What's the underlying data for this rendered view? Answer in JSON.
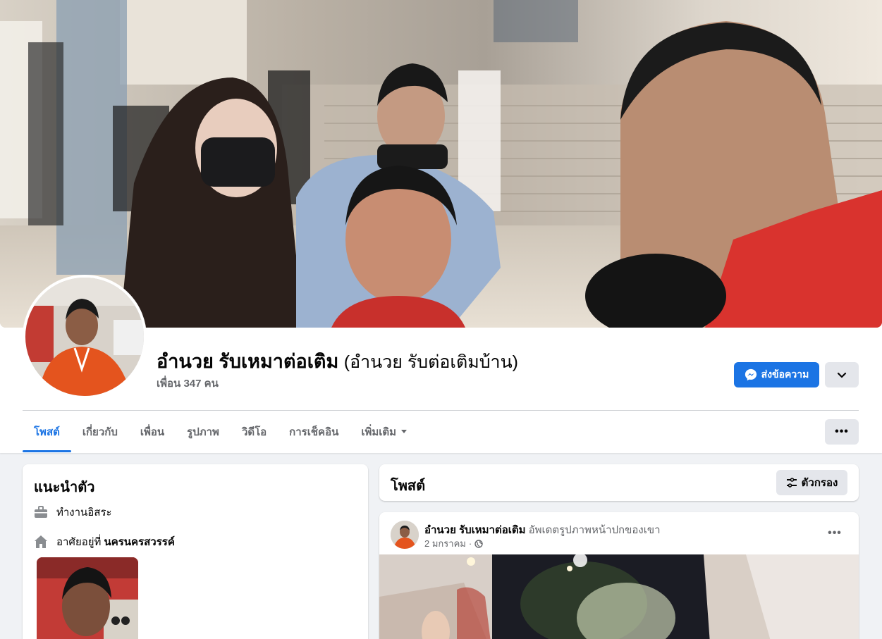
{
  "profile": {
    "name": "อำนวย รับเหมาต่อเติม",
    "alternate_name": "(อำนวย รับต่อเติมบ้าน)",
    "friends_text": "เพื่อน 347 คน",
    "message_button_label": "ส่งข้อความ"
  },
  "tabs": [
    {
      "label": "โพสต์",
      "active": true
    },
    {
      "label": "เกี่ยวกับ",
      "active": false
    },
    {
      "label": "เพื่อน",
      "active": false
    },
    {
      "label": "รูปภาพ",
      "active": false
    },
    {
      "label": "วิดีโอ",
      "active": false
    },
    {
      "label": "การเช็คอิน",
      "active": false
    },
    {
      "label": "เพิ่มเติม",
      "active": false
    }
  ],
  "intro": {
    "title": "แนะนำตัว",
    "work": "ทำงานอิสระ",
    "lives_prefix": "อาศัยอยู่ที่",
    "lives_place": "นครนครสวรรค์"
  },
  "posts": {
    "title": "โพสต์",
    "filter_label": "ตัวกรอง"
  },
  "post": {
    "author": "อำนวย รับเหมาต่อเติม",
    "action": "อัพเดตรูปภาพหน้าปกของเขา",
    "date": "2 มกราคม",
    "privacy_icon": "globe-icon"
  },
  "colors": {
    "accent": "#1b74e4",
    "background": "#f0f2f5",
    "secondary_text": "#65676b",
    "button_gray": "#e4e6eb"
  }
}
